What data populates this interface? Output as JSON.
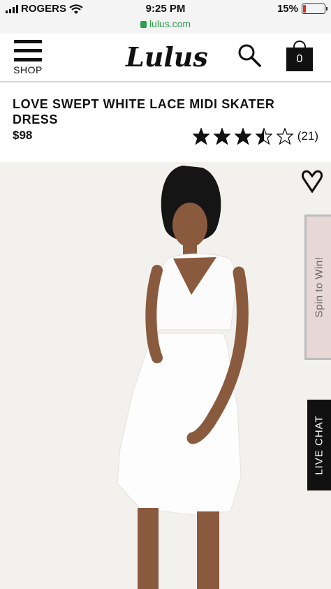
{
  "status_bar": {
    "carrier": "ROGERS",
    "time": "9:25 PM",
    "battery": "15%",
    "battery_level": 0.15
  },
  "browser": {
    "url": "lulus.com"
  },
  "header": {
    "menu_label": "SHOP",
    "logo": "Lulus",
    "cart_count": "0"
  },
  "product": {
    "title": "LOVE SWEPT WHITE LACE MIDI SKATER DRESS",
    "price": "$98",
    "rating_value": 3.5,
    "rating_max": 5,
    "review_count": "(21)"
  },
  "gallery": {
    "spin_label": "Spin to Win!",
    "chat_label": "LIVE CHAT"
  },
  "colors": {
    "url_green": "#2e9e4f",
    "battery_red": "#e0302b",
    "image_bg": "#f2f1ee"
  }
}
